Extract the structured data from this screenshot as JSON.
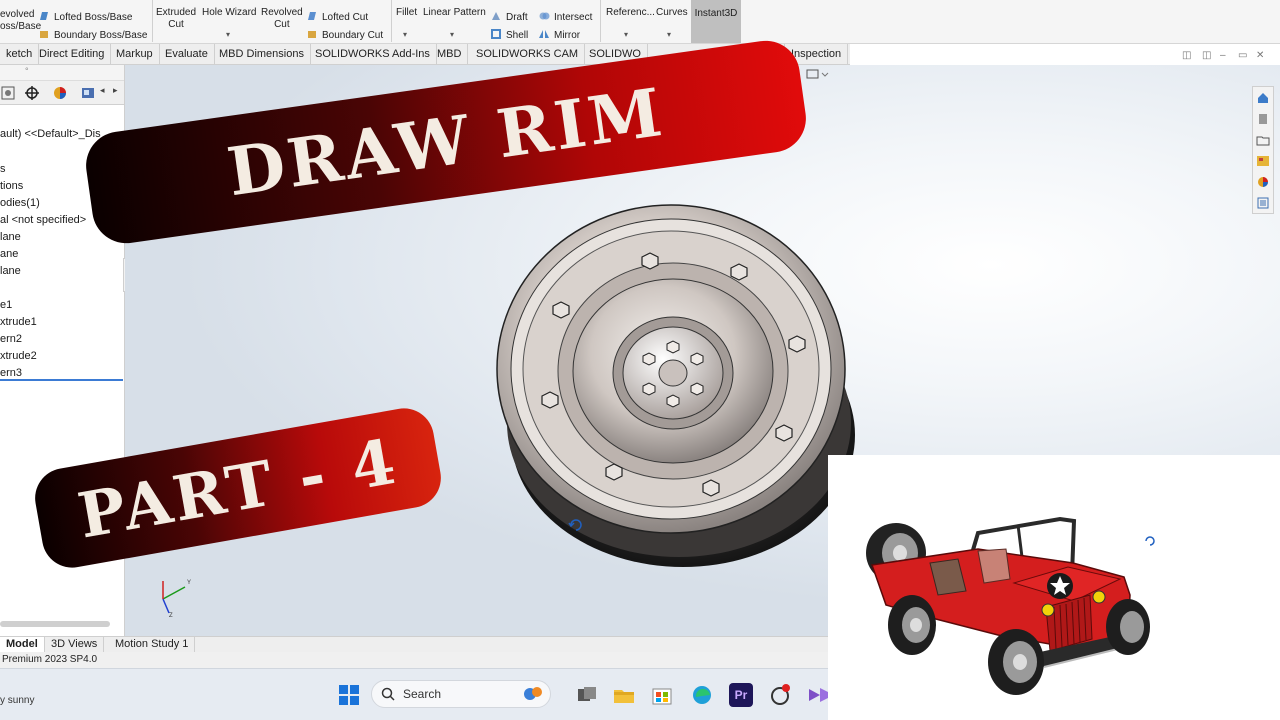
{
  "ribbon": {
    "revolved_boss": [
      "evolved",
      "oss/Base"
    ],
    "lofted_boss": "Lofted Boss/Base",
    "boundary_boss": "Boundary Boss/Base",
    "extruded_cut": [
      "Extruded",
      "Cut"
    ],
    "hole_wizard": "Hole Wizard",
    "revolved_cut": [
      "Revolved",
      "Cut"
    ],
    "lofted_cut": "Lofted Cut",
    "boundary_cut": "Boundary Cut",
    "fillet": "Fillet",
    "linear_pattern": "Linear Pattern",
    "draft": "Draft",
    "intersect": "Intersect",
    "shell": "Shell",
    "mirror": "Mirror",
    "reference": "Referenc...",
    "curves": "Curves",
    "instant3d": "Instant3D"
  },
  "tabs": [
    "ketch",
    "Direct Editing",
    "Markup",
    "Evaluate",
    "MBD Dimensions",
    "SOLIDWORKS Add-Ins",
    "MBD",
    "SOLIDWORKS CAM",
    "SOLIDWO",
    "Inspection"
  ],
  "tree": {
    "header": "ault) <<Default>_Dis",
    "items": [
      "s",
      "tions",
      "odies(1)",
      "al <not specified>",
      "lane",
      "ane",
      "lane",
      "",
      "e1",
      "xtrude1",
      "ern2",
      "xtrude2",
      "ern3"
    ]
  },
  "banners": {
    "top": "DRAW RIM",
    "bottom": "PART - 4"
  },
  "axis": {
    "x": "X",
    "y": "Y",
    "z": "Z"
  },
  "bottom_tabs": [
    "Model",
    "3D Views",
    "Motion Study 1"
  ],
  "status": "Premium 2023 SP4.0",
  "taskbar": {
    "weather": "y sunny",
    "search_label": "Search",
    "premiere_label": "Pr"
  },
  "colors": {
    "banner_dark": "#0a0000",
    "banner_red": "#e10b0b",
    "banner_text": "#f4ece2",
    "jeep_red": "#d41e1e",
    "tree_selection": "#3b7bd4"
  }
}
